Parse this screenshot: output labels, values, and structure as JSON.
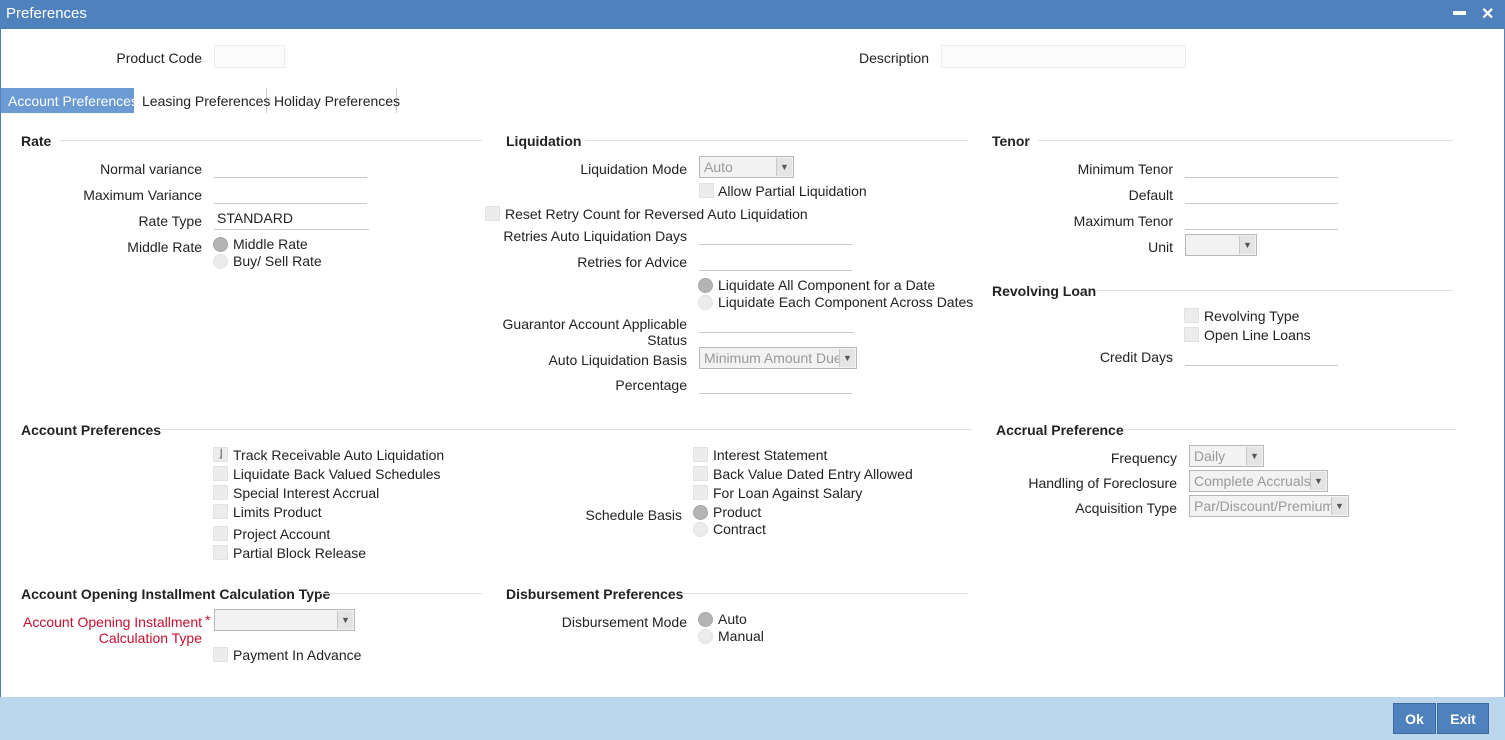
{
  "window": {
    "title": "Preferences",
    "minimize_glyph": "▬",
    "close_glyph": "✕"
  },
  "header": {
    "product_code_label": "Product Code",
    "product_code_value": "",
    "description_label": "Description",
    "description_value": ""
  },
  "tabs": [
    {
      "label": "Account Preferences",
      "active": true
    },
    {
      "label": "Leasing Preferences",
      "active": false
    },
    {
      "label": "Holiday Preferences",
      "active": false
    }
  ],
  "rate": {
    "title": "Rate",
    "normal_variance_label": "Normal variance",
    "normal_variance_value": "",
    "maximum_variance_label": "Maximum Variance",
    "maximum_variance_value": "",
    "rate_type_label": "Rate Type",
    "rate_type_value": "STANDARD",
    "middle_rate_label": "Middle Rate",
    "middle_rate_option": "Middle Rate",
    "buy_sell_option": "Buy/ Sell Rate"
  },
  "liquidation": {
    "title": "Liquidation",
    "mode_label": "Liquidation Mode",
    "mode_value": "Auto",
    "allow_partial": "Allow Partial Liquidation",
    "reset_retry": "Reset Retry Count for Reversed Auto Liquidation",
    "retries_days_label": "Retries Auto Liquidation Days",
    "retries_days_value": "",
    "retries_advice_label": "Retries for Advice",
    "retries_advice_value": "",
    "liq_all_option": "Liquidate All Component for a Date",
    "liq_each_option": "Liquidate Each Component Across Dates",
    "guarantor_label_1": "Guarantor Account Applicable",
    "guarantor_label_2": "Status",
    "guarantor_value": "",
    "basis_label": "Auto Liquidation Basis",
    "basis_value": "Minimum Amount Due",
    "percentage_label": "Percentage",
    "percentage_value": ""
  },
  "tenor": {
    "title": "Tenor",
    "min_label": "Minimum Tenor",
    "min_value": "",
    "default_label": "Default",
    "default_value": "",
    "max_label": "Maximum Tenor",
    "max_value": "",
    "unit_label": "Unit",
    "unit_value": ""
  },
  "revolving": {
    "title": "Revolving Loan",
    "revolving_type": "Revolving Type",
    "open_line": "Open Line Loans",
    "credit_days_label": "Credit Days",
    "credit_days_value": ""
  },
  "account_prefs": {
    "title": "Account Preferences",
    "track_receivable": "Track Receivable Auto Liquidation",
    "track_receivable_mark": "⌋",
    "liquidate_back": "Liquidate Back Valued Schedules",
    "special_interest": "Special Interest Accrual",
    "limits_product": "Limits Product",
    "project_account": "Project Account",
    "partial_block": "Partial Block Release",
    "interest_statement": "Interest Statement",
    "back_value_dated": "Back Value Dated Entry Allowed",
    "loan_against_salary": "For Loan Against Salary",
    "schedule_basis_label": "Schedule Basis",
    "schedule_product": "Product",
    "schedule_contract": "Contract"
  },
  "accrual": {
    "title": "Accrual Preference",
    "frequency_label": "Frequency",
    "frequency_value": "Daily",
    "foreclosure_label": "Handling of Foreclosure",
    "foreclosure_value": "Complete Accruals",
    "acquisition_label": "Acquisition Type",
    "acquisition_value": "Par/Discount/Premium"
  },
  "installment": {
    "title": "Account Opening Installment Calculation Type",
    "label_1": "Account Opening Installment",
    "label_2": "Calculation Type",
    "required_mark": "*",
    "value": "",
    "payment_in_advance": "Payment In Advance"
  },
  "disbursement": {
    "title": "Disbursement Preferences",
    "mode_label": "Disbursement Mode",
    "auto": "Auto",
    "manual": "Manual"
  },
  "footer": {
    "ok_label": "Ok",
    "exit_label": "Exit"
  },
  "colors": {
    "titlebar": "#4f81bd",
    "active_tab": "#6b9bd2",
    "footer": "#bcd6ee",
    "required": "#c8102e"
  },
  "icons": {
    "dropdown": "dropdown-arrow-icon",
    "close": "close-icon",
    "minimize": "minimize-icon"
  }
}
